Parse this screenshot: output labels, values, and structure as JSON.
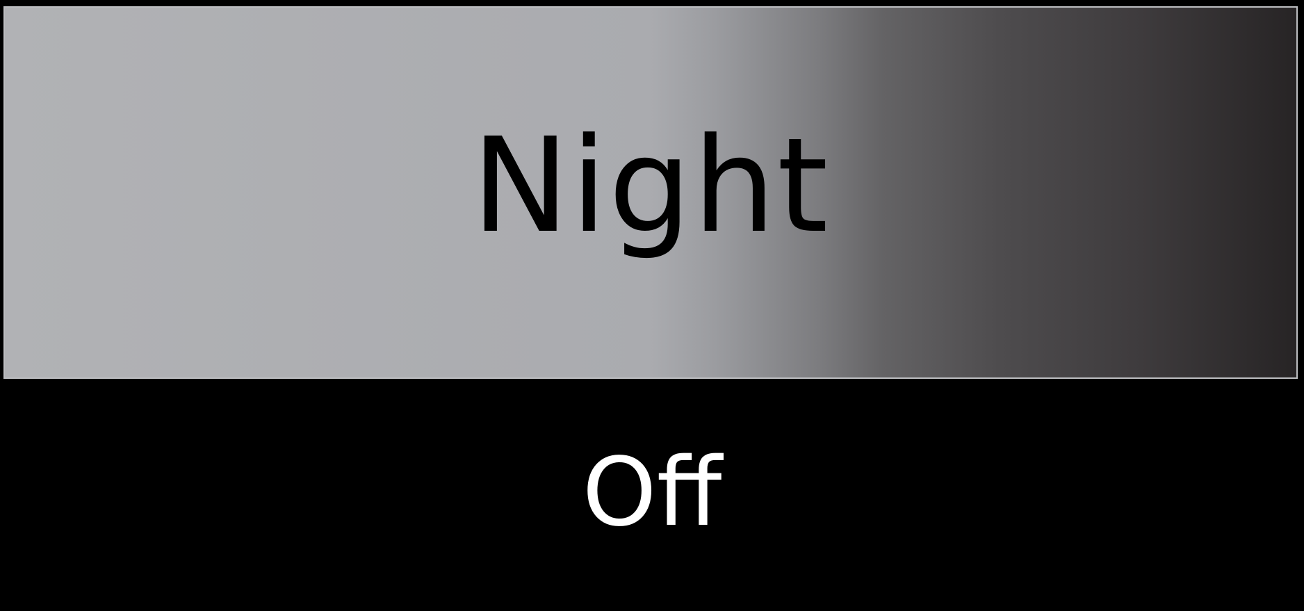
{
  "mode_button": {
    "label": "Night"
  },
  "status": {
    "label": "Off"
  },
  "colors": {
    "background": "#000000",
    "button_gradient_start": "#b1b2b5",
    "button_gradient_end": "#272425",
    "button_border": "#bdbec1",
    "button_text": "#000000",
    "status_text": "#ffffff"
  }
}
